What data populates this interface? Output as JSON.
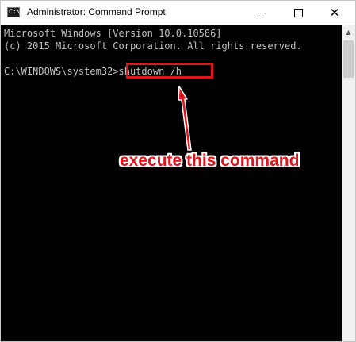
{
  "window": {
    "title": "Administrator: Command Prompt",
    "icon": "cmd-icon",
    "controls": {
      "minimize": "minimize-icon",
      "maximize": "maximize-icon",
      "close": "close-icon"
    }
  },
  "console": {
    "lines": [
      "Microsoft Windows [Version 10.0.10586]",
      "(c) 2015 Microsoft Corporation. All rights reserved."
    ],
    "prompt": "C:\\WINDOWS\\system32>",
    "command": "shutdown /h"
  },
  "annotation": {
    "text": "execute this command",
    "color": "#e0141b"
  },
  "colors": {
    "console_bg": "#000000",
    "console_text": "#c0c0c0",
    "highlight": "#e0141b"
  }
}
